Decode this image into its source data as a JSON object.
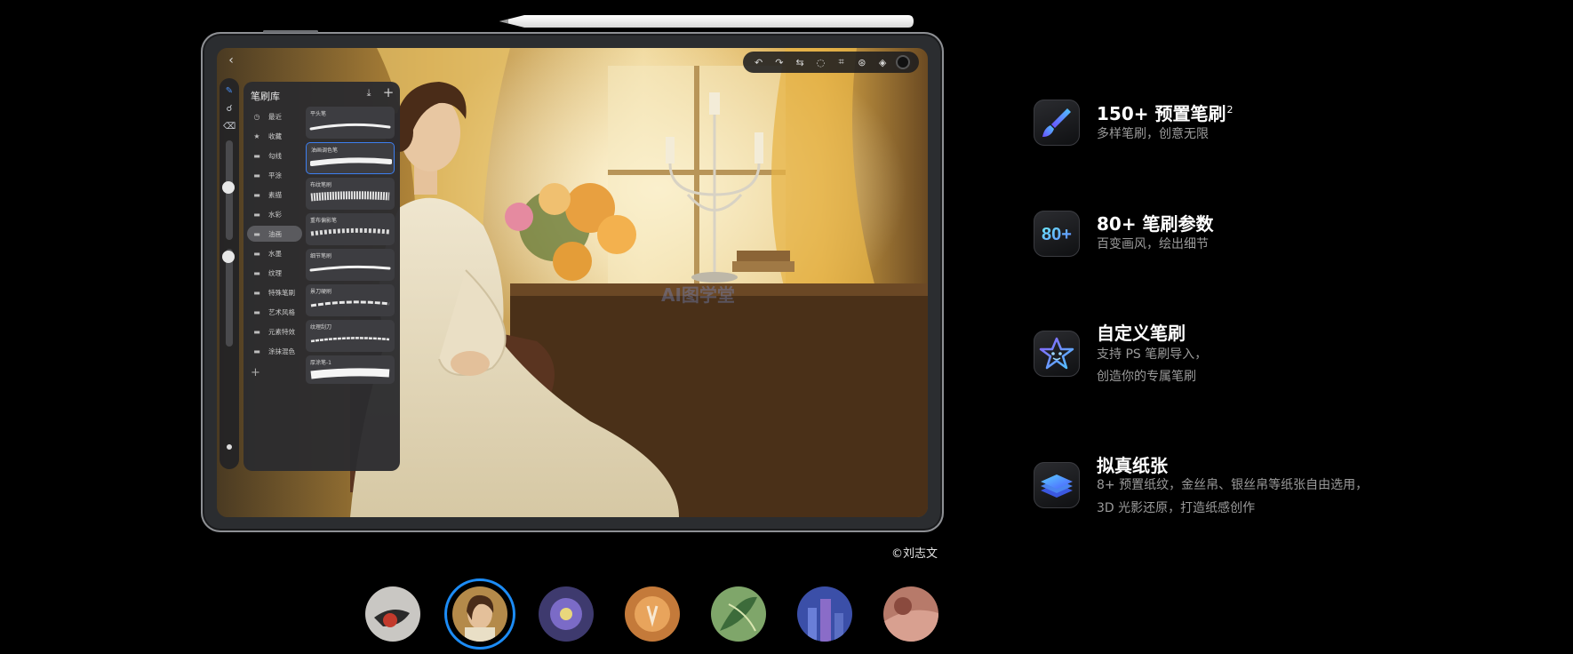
{
  "credit": "©刘志文",
  "watermark": "AI图学堂",
  "brush_library": {
    "title": "笔刷库",
    "categories": [
      {
        "label": "最近",
        "icon": "clock-icon"
      },
      {
        "label": "收藏",
        "icon": "star-icon"
      },
      {
        "label": "勾线",
        "icon": "brush-icon"
      },
      {
        "label": "平涂",
        "icon": "brush-icon"
      },
      {
        "label": "素描",
        "icon": "pencil-icon"
      },
      {
        "label": "水彩",
        "icon": "brush-icon"
      },
      {
        "label": "油画",
        "icon": "brush-icon"
      },
      {
        "label": "水墨",
        "icon": "brush-icon"
      },
      {
        "label": "纹理",
        "icon": "brush-icon"
      },
      {
        "label": "特殊笔刷",
        "icon": "brush-icon"
      },
      {
        "label": "艺术风格",
        "icon": "brush-icon"
      },
      {
        "label": "元素特效",
        "icon": "brush-icon"
      },
      {
        "label": "涂抹混色",
        "icon": "brush-icon"
      }
    ],
    "selected_category": "油画",
    "brushes": [
      {
        "label": "平头笔"
      },
      {
        "label": "油画调色笔"
      },
      {
        "label": "布纹笔刷"
      },
      {
        "label": "重布偏影笔"
      },
      {
        "label": "细节笔刷"
      },
      {
        "label": "景刀硬刷"
      },
      {
        "label": "纹理刮刀"
      },
      {
        "label": "厚涂笔-1"
      }
    ],
    "selected_brush": "油画调色笔"
  },
  "features": [
    {
      "title": "150+ 预置笔刷",
      "sup": "2",
      "desc": [
        "多样笔刷，创意无限"
      ],
      "icon": "paintbrush-icon"
    },
    {
      "title": "80+ 笔刷参数",
      "sup": "",
      "desc": [
        "百变画风，绘出细节"
      ],
      "icon": "parameters-80-icon",
      "icon_text": "80+"
    },
    {
      "title": "自定义笔刷",
      "sup": "",
      "desc": [
        "支持 PS 笔刷导入，",
        "创造你的专属笔刷"
      ],
      "icon": "star-face-icon"
    },
    {
      "title": "拟真纸张",
      "sup": "",
      "desc": [
        "8+ 预置纸纹，金丝帛、银丝帛等纸张自由选用，",
        "3D 光影还原，打造纸感创作"
      ],
      "icon": "paper-stack-icon"
    }
  ],
  "thumbnails": [
    {
      "name": "thumb-ink-bird"
    },
    {
      "name": "thumb-portrait-woman",
      "selected": true
    },
    {
      "name": "thumb-purple-flower"
    },
    {
      "name": "thumb-deer"
    },
    {
      "name": "thumb-green-leaves"
    },
    {
      "name": "thumb-blue-city"
    },
    {
      "name": "thumb-pink-abstract"
    }
  ],
  "colors": {
    "accent": "#1c8cf6",
    "selected_brush_border": "#3d7ff0"
  }
}
